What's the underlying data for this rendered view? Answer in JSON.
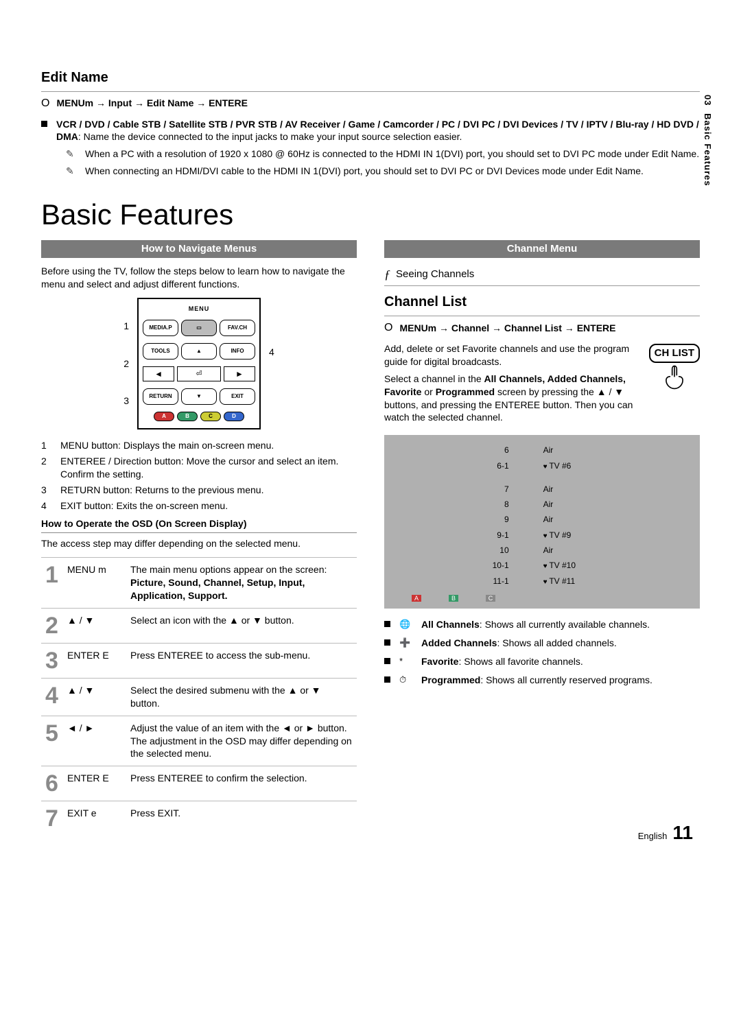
{
  "side_tab": {
    "num": "03",
    "label": "Basic Features"
  },
  "edit_name": {
    "title": "Edit Name",
    "menu_icon": "O",
    "menu_path": "MENUm  → Input → Edit Name → ENTERE",
    "bullet": "VCR / DVD / Cable STB / Satellite STB / PVR STB / AV Receiver / Game / Camcorder / PC / DVI PC / DVI Devices / TV / IPTV / Blu-ray / HD DVD / DMA",
    "bullet_rest": ": Name the device connected to the input jacks to make your input source selection easier.",
    "note1": "When a PC with a resolution of 1920 x 1080 @ 60Hz is connected to the HDMI IN 1(DVI) port, you should set to DVI PC mode under Edit Name.",
    "note2": "When connecting an HDMI/DVI cable to the HDMI IN 1(DVI) port, you should set to DVI PC or DVI Devices mode under Edit Name."
  },
  "main_title": "Basic Features",
  "left": {
    "band": "How to Navigate Menus",
    "intro": "Before using the TV, follow the steps below to learn how to navigate the menu and select and adjust different functions.",
    "callouts": {
      "c1": "1",
      "c2": "2",
      "c3": "3",
      "c4": "4"
    },
    "remote": {
      "menu_label": "MENU",
      "mediap": "MEDIA.P",
      "favch": "FAV.CH",
      "tools": "TOOLS",
      "info": "INFO",
      "ret": "RETURN",
      "exit": "EXIT",
      "enter": "⏎",
      "a": "A",
      "b": "B",
      "c": "C",
      "d": "D"
    },
    "defs": [
      {
        "n": "1",
        "t": "MENU button: Displays the main on-screen menu."
      },
      {
        "n": "2",
        "t": "ENTEREE / Direction button: Move the cursor and select an item. Confirm the setting."
      },
      {
        "n": "3",
        "t": "RETURN button: Returns to the previous menu."
      },
      {
        "n": "4",
        "t": "EXIT button: Exits the on-screen menu."
      }
    ],
    "osd_head": "How to Operate the OSD (On Screen Display)",
    "osd_note": "The access step may differ depending on the selected menu.",
    "osd": [
      {
        "n": "1",
        "key": "MENU m",
        "desc_a": "The main menu options appear on the screen:",
        "desc_b": "Picture, Sound, Channel, Setup, Input, Application, Support."
      },
      {
        "n": "2",
        "key": "▲ / ▼",
        "desc_a": "Select an icon with the ▲ or ▼ button.",
        "desc_b": ""
      },
      {
        "n": "3",
        "key": "ENTER E",
        "desc_a": "Press ENTEREE to access the sub-menu.",
        "desc_b": ""
      },
      {
        "n": "4",
        "key": "▲ / ▼",
        "desc_a": "Select the desired submenu with the ▲ or ▼ button.",
        "desc_b": ""
      },
      {
        "n": "5",
        "key": "◄ / ►",
        "desc_a": "Adjust the value of an item with the ◄ or ► button. The adjustment in the OSD may differ depending on the selected menu.",
        "desc_b": ""
      },
      {
        "n": "6",
        "key": "ENTER E",
        "desc_a": "Press ENTEREE to confirm the selection.",
        "desc_b": ""
      },
      {
        "n": "7",
        "key": "EXIT e",
        "desc_a": "Press EXIT.",
        "desc_b": ""
      }
    ]
  },
  "right": {
    "band": "Channel Menu",
    "seeing_icon": "ƒ",
    "seeing": "Seeing Channels",
    "list_title": "Channel List",
    "menu_icon": "O",
    "menu_path": "MENUm  → Channel → Channel List → ENTERE",
    "badge": "CH LIST",
    "d1": "Add, delete or set Favorite channels and use the program guide for digital broadcasts.",
    "d2a": "Select a channel in the ",
    "d2b": "All Channels, Added Channels, Favorite",
    "d2c": " or ",
    "d2d": "Programmed",
    "d2e": " screen by pressing the ▲ / ▼ buttons, and pressing the ENTEREE button. Then you can watch the selected channel.",
    "rows": [
      {
        "num": "6",
        "name": "Air",
        "fav": false
      },
      {
        "num": "6-1",
        "name": "TV #6",
        "fav": true
      },
      {
        "num": "7",
        "name": "Air",
        "fav": false
      },
      {
        "num": "8",
        "name": "Air",
        "fav": false
      },
      {
        "num": "9",
        "name": "Air",
        "fav": false
      },
      {
        "num": "9-1",
        "name": "TV #9",
        "fav": true
      },
      {
        "num": "10",
        "name": "Air",
        "fav": false
      },
      {
        "num": "10-1",
        "name": "TV #10",
        "fav": true
      },
      {
        "num": "11-1",
        "name": "TV #11",
        "fav": true
      }
    ],
    "abc": {
      "a": "A",
      "b": "B",
      "c": "C"
    },
    "legend": [
      {
        "icon": "🌐",
        "bold": "All Channels",
        "rest": ": Shows all currently available channels."
      },
      {
        "icon": "➕",
        "bold": "Added Channels",
        "rest": ": Shows all added channels."
      },
      {
        "icon": "*",
        "bold": "Favorite",
        "rest": ": Shows all favorite channels."
      },
      {
        "icon": "⏱",
        "bold": "Programmed",
        "rest": ": Shows all currently reserved programs."
      }
    ]
  },
  "footer": {
    "lang": "English",
    "page": "11"
  }
}
